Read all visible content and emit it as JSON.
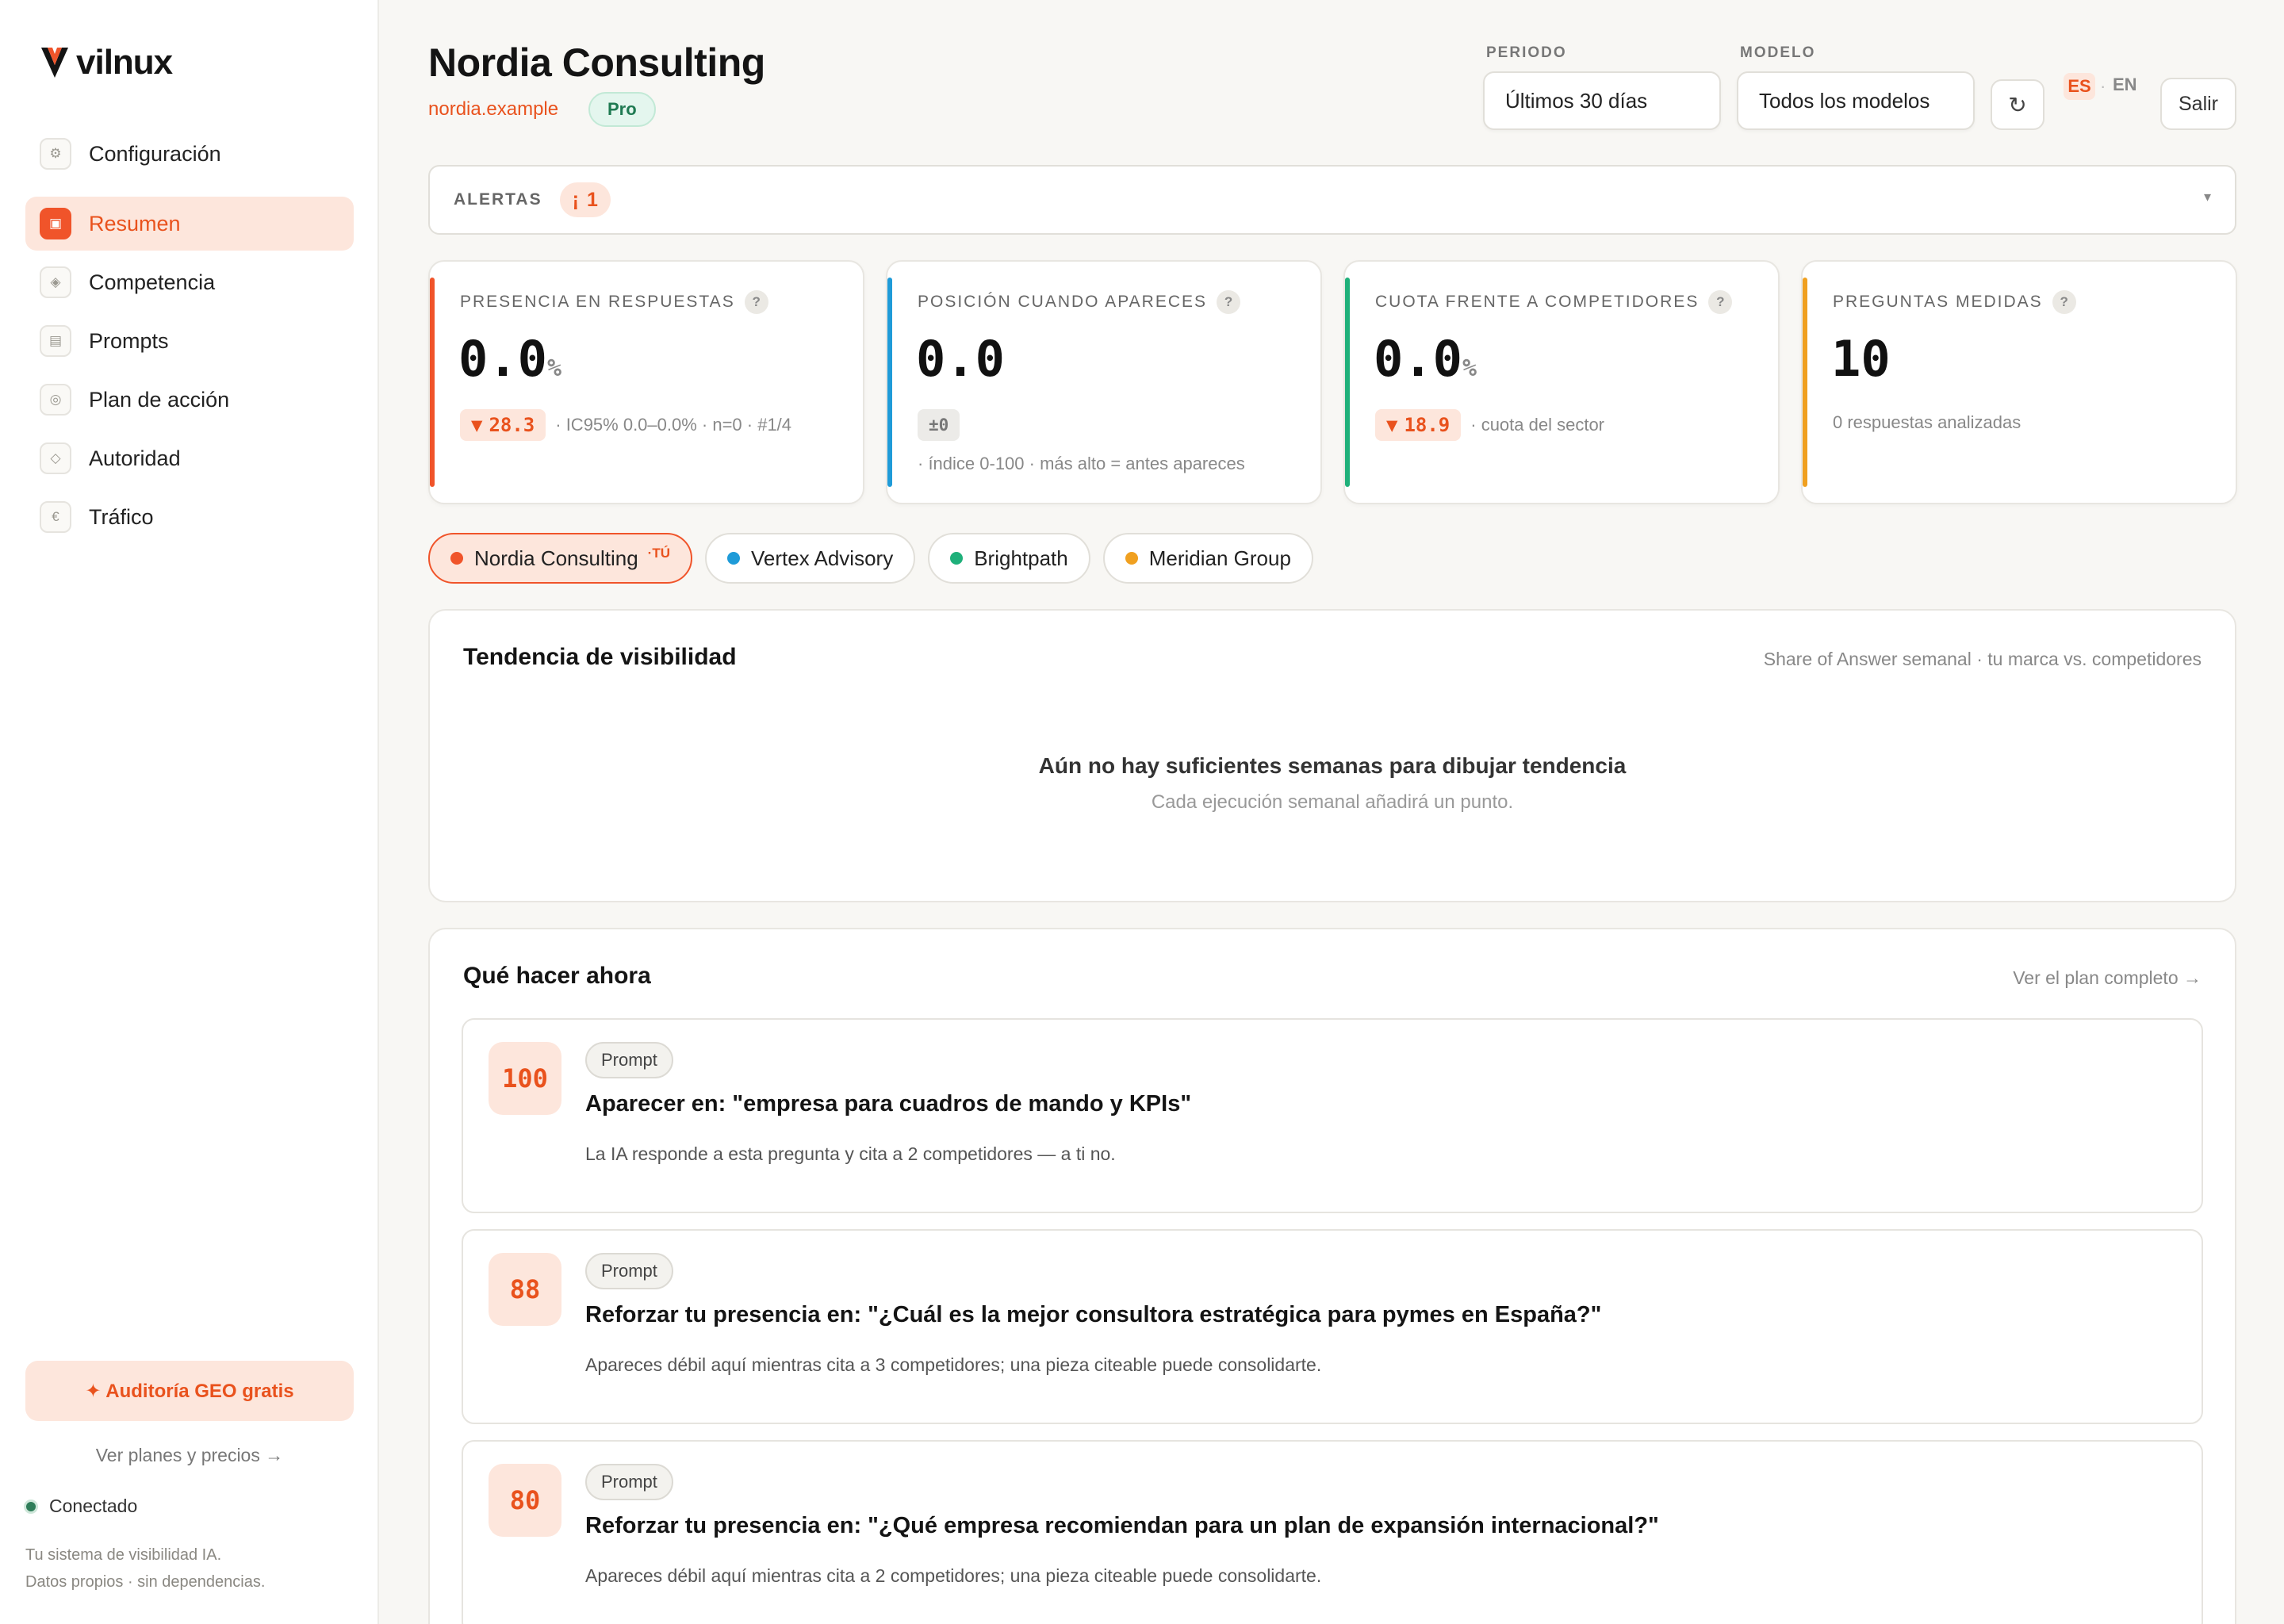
{
  "app": {
    "logo_text": "vilnux"
  },
  "sidebar": {
    "items": [
      {
        "label": "Configuración",
        "icon": "gear-icon",
        "glyph": "⚙",
        "active": false
      },
      {
        "label": "Resumen",
        "icon": "dashboard-icon",
        "glyph": "▣",
        "active": true
      },
      {
        "label": "Competencia",
        "icon": "diamond-icon",
        "glyph": "◈",
        "active": false
      },
      {
        "label": "Prompts",
        "icon": "list-icon",
        "glyph": "▤",
        "active": false
      },
      {
        "label": "Plan de acción",
        "icon": "target-icon",
        "glyph": "◎",
        "active": false
      },
      {
        "label": "Autoridad",
        "icon": "diamond-outline-icon",
        "glyph": "◇",
        "active": false
      },
      {
        "label": "Tráfico",
        "icon": "euro-icon",
        "glyph": "€",
        "active": false
      }
    ],
    "audit_button": "✦ Auditoría GEO gratis",
    "plans_link": "Ver planes y precios →",
    "status": "Conectado",
    "footer_line1": "Tu sistema de visibilidad IA.",
    "footer_line2": "Datos propios · sin dependencias."
  },
  "header": {
    "title": "Nordia Consulting",
    "domain": "nordia.example",
    "plan_badge": "Pro",
    "period_label": "PERIODO",
    "period_value": "Últimos 30 días",
    "model_label": "MODELO",
    "model_value": "Todos los modelos",
    "refresh_glyph": "↻",
    "lang_es": "ES",
    "lang_sep": "·",
    "lang_en": "EN",
    "logout": "Salir"
  },
  "alerts": {
    "label": "ALERTAS",
    "icon_glyph": "¡",
    "count": "1",
    "chevron": "▾"
  },
  "kpis": [
    {
      "label": "PRESENCIA EN RESPUESTAS",
      "value": "0.0",
      "unit": "%",
      "delta": "28.3",
      "delta_glyph": "▼",
      "detail": "· IC95% 0.0–0.0% · n=0 · #1/4",
      "accent": "#f0542a"
    },
    {
      "label": "POSICIÓN CUANDO APARECES",
      "value": "0.0",
      "unit": "",
      "delta": "±0",
      "detail": "· índice 0-100 · más alto = antes apareces",
      "accent": "#1f9bd8"
    },
    {
      "label": "CUOTA FRENTE A COMPETIDORES",
      "value": "0.0",
      "unit": "%",
      "delta": "18.9",
      "delta_glyph": "▼",
      "detail": "· cuota del sector",
      "accent": "#1fb07a"
    },
    {
      "label": "PREGUNTAS MEDIDAS",
      "value": "10",
      "unit": "",
      "detail": "0 respuestas analizadas",
      "accent": "#f0a020"
    }
  ],
  "help_glyph": "?",
  "brands": [
    {
      "name": "Nordia Consulting",
      "tag": "·TÚ",
      "color": "#f0542a",
      "active": true
    },
    {
      "name": "Vertex Advisory",
      "color": "#1f9bd8",
      "active": false
    },
    {
      "name": "Brightpath",
      "color": "#1fb07a",
      "active": false
    },
    {
      "name": "Meridian Group",
      "color": "#f0a020",
      "active": false
    }
  ],
  "trend": {
    "title": "Tendencia de visibilidad",
    "subtitle": "Share of Answer semanal · tu marca vs. competidores",
    "empty_title": "Aún no hay suficientes semanas para dibujar tendencia",
    "empty_sub": "Cada ejecución semanal añadirá un punto."
  },
  "actions": {
    "title": "Qué hacer ahora",
    "link": "Ver el plan completo →",
    "items": [
      {
        "score": "100",
        "tag": "Prompt",
        "title": "Aparecer en: \"empresa para cuadros de mando y KPIs\"",
        "desc": "La IA responde a esta pregunta y cita a 2 competidores — a ti no."
      },
      {
        "score": "88",
        "tag": "Prompt",
        "title": "Reforzar tu presencia en: \"¿Cuál es la mejor consultora estratégica para pymes en España?\"",
        "desc": "Apareces débil aquí mientras cita a 3 competidores; una pieza citeable puede consolidarte."
      },
      {
        "score": "80",
        "tag": "Prompt",
        "title": "Reforzar tu presencia en: \"¿Qué empresa recomiendan para un plan de expansión internacional?\"",
        "desc": "Apareces débil aquí mientras cita a 2 competidores; una pieza citeable puede consolidarte."
      }
    ]
  }
}
